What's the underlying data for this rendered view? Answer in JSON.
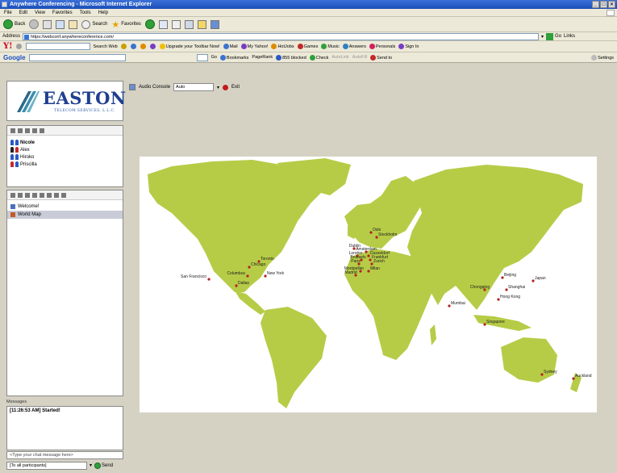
{
  "window": {
    "title": "Anywhere Conferencing - Microsoft Internet Explorer"
  },
  "menu": [
    "File",
    "Edit",
    "View",
    "Favorites",
    "Tools",
    "Help"
  ],
  "nav": {
    "back": "Back",
    "search": "Search",
    "favorites": "Favorites"
  },
  "address": {
    "label": "Address",
    "url": "https://webconf.anywhereconference.com/",
    "go": "Go",
    "links": "Links"
  },
  "yahoo": {
    "logo": "Y!",
    "search_web": "Search Web",
    "items": [
      "Upgrade your Toolbar Now!",
      "Mail",
      "My Yahoo!",
      "HotJobs",
      "Games",
      "Music",
      "Answers",
      "Personals",
      "Sign In"
    ]
  },
  "google": {
    "logo": "Google",
    "go": "Go",
    "bookmarks": "Bookmarks",
    "pagerank": "PageRank",
    "rss": "855 blocked",
    "check": "Check",
    "autolink": "AutoLink",
    "autofill": "AutoFill",
    "sendto": "Send to",
    "settings": "Settings"
  },
  "brand": {
    "name": "EASTON",
    "sub": "TELECOM SERVICES, L.L.C."
  },
  "users": [
    {
      "name": "Nicole",
      "color": "#2a58c4"
    },
    {
      "name": "Alex",
      "color": "#222222"
    },
    {
      "name": "Hiroko",
      "color": "#2a58c4"
    },
    {
      "name": "Priscilla",
      "color": "#c42a2a"
    }
  ],
  "content_items": [
    "Welcome!",
    "World Map"
  ],
  "messages": {
    "label": "Messages",
    "log": "[11:26:53 AM] Started!"
  },
  "chat": {
    "placeholder": "<Type your chat message here>",
    "recipient": "[To all participants]",
    "send": "Send"
  },
  "audio": {
    "console": "Audio Console",
    "mode": "Auto",
    "exit": "Exit"
  },
  "map": {
    "land_color": "#b6cc47",
    "dot_color": "#b22222",
    "cities": [
      {
        "name": "San Francisco"
      },
      {
        "name": "Toronto"
      },
      {
        "name": "Chicago"
      },
      {
        "name": "Columbus"
      },
      {
        "name": "New York"
      },
      {
        "name": "Dallas"
      },
      {
        "name": "Oslo"
      },
      {
        "name": "Stockholm"
      },
      {
        "name": "Dublin"
      },
      {
        "name": "Amsterdam"
      },
      {
        "name": "London"
      },
      {
        "name": "Brussels"
      },
      {
        "name": "Dusseldorf"
      },
      {
        "name": "Frankfurt"
      },
      {
        "name": "Paris"
      },
      {
        "name": "Zurich"
      },
      {
        "name": "Milan"
      },
      {
        "name": "Montpellier"
      },
      {
        "name": "Madrid"
      },
      {
        "name": "Beijing"
      },
      {
        "name": "Japan"
      },
      {
        "name": "Chongqing"
      },
      {
        "name": "Shanghai"
      },
      {
        "name": "Hong Kong"
      },
      {
        "name": "Mumbai"
      },
      {
        "name": "Singapore"
      },
      {
        "name": "Sydney"
      },
      {
        "name": "Auckland"
      }
    ]
  }
}
